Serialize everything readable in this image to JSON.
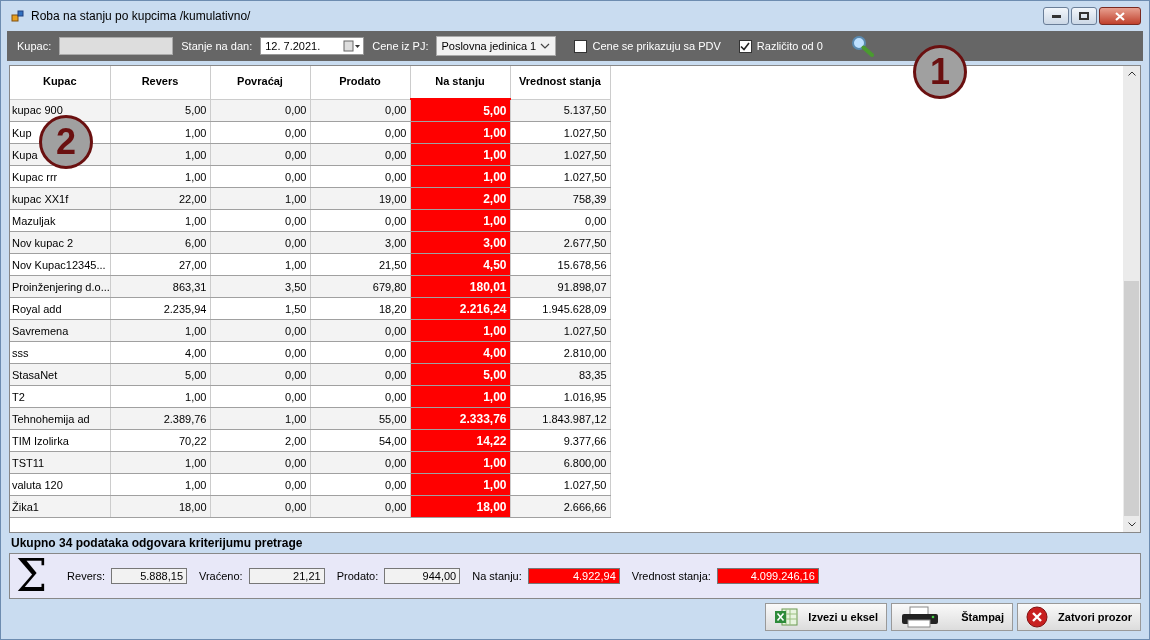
{
  "window": {
    "title": "Roba na stanju po kupcima /kumulativno/"
  },
  "toolbar": {
    "kupac_label": "Kupac:",
    "date_label": "Stanje na dan:",
    "date_value": "12.  7.2021.",
    "pj_label": "Cene iz PJ:",
    "pj_value": "Poslovna jedinica 1",
    "checkboxes": [
      {
        "label": "Cene se prikazuju sa PDV",
        "checked": false
      },
      {
        "label": "Različito od 0",
        "checked": true
      }
    ]
  },
  "callouts": [
    "1",
    "2"
  ],
  "table": {
    "columns": [
      "Kupac",
      "Revers",
      "Povraćaj",
      "Prodato",
      "Na stanju",
      "Vrednost stanja"
    ],
    "rows": [
      [
        "kupac 900",
        "5,00",
        "0,00",
        "0,00",
        "5,00",
        "5.137,50"
      ],
      [
        "Kup",
        "1,00",
        "0,00",
        "0,00",
        "1,00",
        "1.027,50"
      ],
      [
        "Kupa",
        "1,00",
        "0,00",
        "0,00",
        "1,00",
        "1.027,50"
      ],
      [
        "Kupac rrr",
        "1,00",
        "0,00",
        "0,00",
        "1,00",
        "1.027,50"
      ],
      [
        "kupac XX1f",
        "22,00",
        "1,00",
        "19,00",
        "2,00",
        "758,39"
      ],
      [
        "Mazuljak",
        "1,00",
        "0,00",
        "0,00",
        "1,00",
        "0,00"
      ],
      [
        "Nov kupac 2",
        "6,00",
        "0,00",
        "3,00",
        "3,00",
        "2.677,50"
      ],
      [
        "Nov Kupac12345...",
        "27,00",
        "1,00",
        "21,50",
        "4,50",
        "15.678,56"
      ],
      [
        "Proinženjering d.o...",
        "863,31",
        "3,50",
        "679,80",
        "180,01",
        "91.898,07"
      ],
      [
        "Royal add",
        "2.235,94",
        "1,50",
        "18,20",
        "2.216,24",
        "1.945.628,09"
      ],
      [
        "Savremena",
        "1,00",
        "0,00",
        "0,00",
        "1,00",
        "1.027,50"
      ],
      [
        "sss",
        "4,00",
        "0,00",
        "0,00",
        "4,00",
        "2.810,00"
      ],
      [
        "StasaNet",
        "5,00",
        "0,00",
        "0,00",
        "5,00",
        "83,35"
      ],
      [
        "T2",
        "1,00",
        "0,00",
        "0,00",
        "1,00",
        "1.016,95"
      ],
      [
        "Tehnohemija ad",
        "2.389,76",
        "1,00",
        "55,00",
        "2.333,76",
        "1.843.987,12"
      ],
      [
        "TIM Izolirka",
        "70,22",
        "2,00",
        "54,00",
        "14,22",
        "9.377,66"
      ],
      [
        "TST11",
        "1,00",
        "0,00",
        "0,00",
        "1,00",
        "6.800,00"
      ],
      [
        "valuta 120",
        "1,00",
        "0,00",
        "0,00",
        "1,00",
        "1.027,50"
      ],
      [
        "Žika1",
        "18,00",
        "0,00",
        "0,00",
        "18,00",
        "2.666,66"
      ]
    ]
  },
  "status": "Ukupno 34 podataka odgovara kriterijumu pretrage",
  "summary_symbol": "Σ",
  "summary": [
    {
      "label": "Revers:",
      "value": "5.888,15",
      "highlighted": false
    },
    {
      "label": "Vraćeno:",
      "value": "21,21",
      "highlighted": false
    },
    {
      "label": "Prodato:",
      "value": "944,00",
      "highlighted": false
    },
    {
      "label": "Na stanju:",
      "value": "4.922,94",
      "highlighted": true
    },
    {
      "label": "Vrednost stanja:",
      "value": "4.099.246,16",
      "highlighted": true
    }
  ],
  "buttons": [
    {
      "kind": "excel",
      "label": "Izvezi u eksel"
    },
    {
      "kind": "print",
      "label": "Štampaj"
    },
    {
      "kind": "close",
      "label": "Zatvori prozor"
    }
  ]
}
